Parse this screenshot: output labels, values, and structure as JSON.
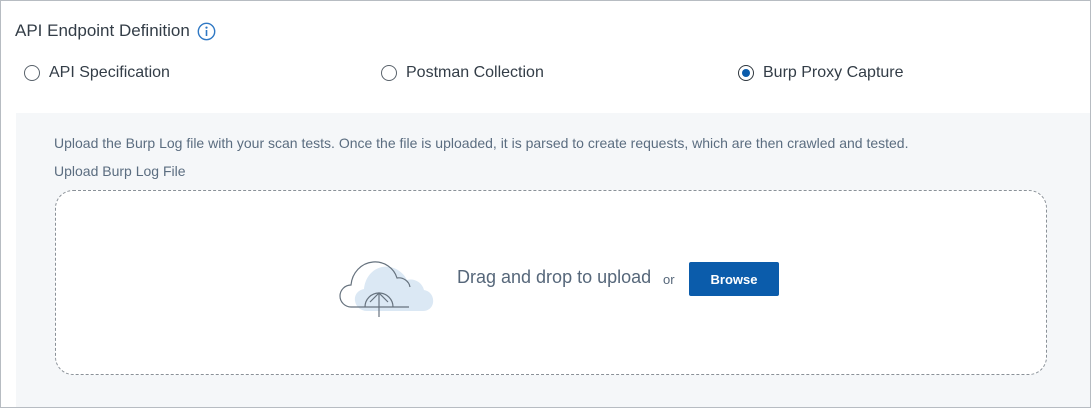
{
  "header": {
    "title": "API Endpoint Definition",
    "info_icon": "info-circle-icon"
  },
  "options": [
    {
      "label": "API Specification",
      "selected": false
    },
    {
      "label": "Postman Collection",
      "selected": false
    },
    {
      "label": "Burp Proxy Capture",
      "selected": true
    }
  ],
  "upload": {
    "description": "Upload the Burp Log file with your scan tests. Once the file is uploaded, it is parsed to create requests, which are then crawled and tested.",
    "field_label": "Upload Burp Log File",
    "drop_icon": "cloud-upload-icon",
    "drag_text": "Drag and drop to upload",
    "or_text": "or",
    "browse_label": "Browse"
  },
  "colors": {
    "accent": "#0b5cab",
    "upload_background": "#f5f7f9",
    "cloud_fill": "#dbe8f4"
  }
}
